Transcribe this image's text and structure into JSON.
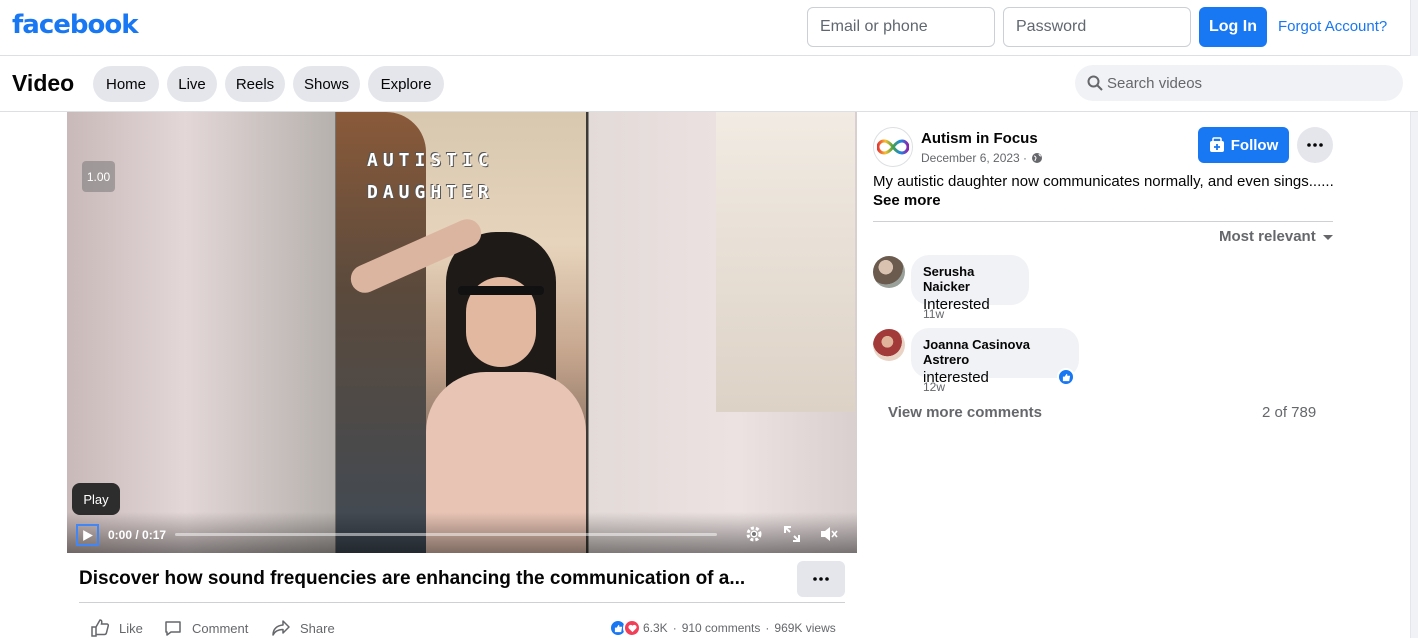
{
  "header": {
    "logo": "facebook",
    "email_placeholder": "Email or phone",
    "password_placeholder": "Password",
    "login_label": "Log In",
    "forgot_label": "Forgot Account?"
  },
  "video_nav": {
    "title": "Video",
    "tabs": [
      {
        "label": "Home"
      },
      {
        "label": "Live"
      },
      {
        "label": "Reels"
      },
      {
        "label": "Shows"
      },
      {
        "label": "Explore"
      }
    ],
    "search_placeholder": "Search videos"
  },
  "player": {
    "overlay_line1": "AUTISTIC",
    "overlay_line2": "DAUGHTER",
    "speed": "1.00",
    "tooltip": "Play",
    "time": "0:00 / 0:17",
    "progress": 0
  },
  "video_info": {
    "title": "Discover how sound frequencies are enhancing the communication of a...",
    "actions": {
      "like": "Like",
      "comment": "Comment",
      "share": "Share"
    },
    "reactions_count": "6.3K",
    "comments_count": "910 comments",
    "views": "969K views"
  },
  "page": {
    "name": "Autism in Focus",
    "date": "December 6, 2023 ·",
    "follow_label": "Follow",
    "post_text": "My autistic daughter now communicates normally, and even sings......",
    "see_more": "See more"
  },
  "comments": {
    "sort_label": "Most relevant",
    "items": [
      {
        "name": "Serusha Naicker",
        "text": "Interested",
        "time": "11w"
      },
      {
        "name": "Joanna Casinova Astrero",
        "text": "interested",
        "time": "12w"
      }
    ],
    "view_more": "View more comments",
    "count": "2 of 789"
  },
  "colors": {
    "brand": "#1877f2",
    "love": "#f33e58",
    "pill_bg": "#e4e6eb",
    "muted_text": "#65676b"
  },
  "icons": [
    "search-icon",
    "play-icon",
    "gear-icon",
    "fullscreen-icon",
    "mute-icon",
    "more-icon",
    "like-icon",
    "comment-icon",
    "share-icon",
    "globe-icon",
    "follow-icon",
    "caret-down-icon",
    "infinity-logo-icon"
  ]
}
